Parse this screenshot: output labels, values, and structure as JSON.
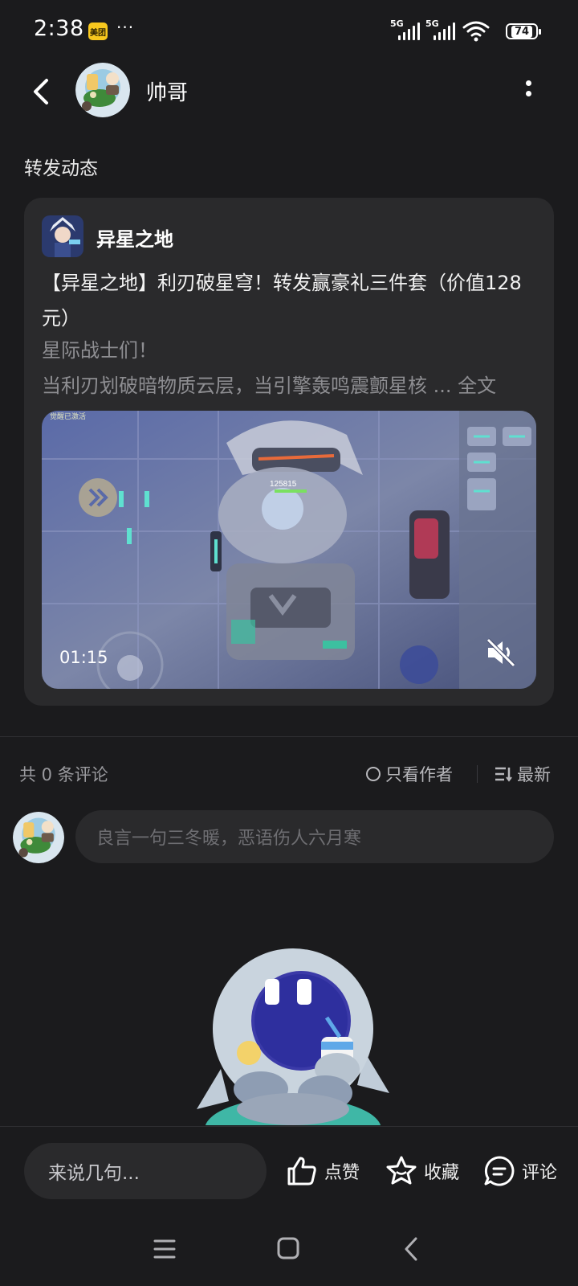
{
  "status_bar": {
    "time": "2:38",
    "app_badge": "美团",
    "more_dots": "···",
    "signal1_label": "5G",
    "signal2_label": "5G",
    "battery": "74"
  },
  "header": {
    "username": "帅哥"
  },
  "section_title": "转发动态",
  "post": {
    "game_name": "异星之地",
    "title": "【异星之地】利刃破星穹！转发赢豪礼三件套（价值128元）",
    "subtitle": "星际战士们！",
    "body": "当利刃划破暗物质云层，当引擎轰鸣震颤星核",
    "ellipsis": " ... ",
    "full_text_link": "全文",
    "video_duration": "01:15"
  },
  "comments": {
    "count_text": "共 0 条评论",
    "author_only_label": "只看作者",
    "sort_label": "最新",
    "input_placeholder": "良言一句三冬暖，恶语伤人六月寒"
  },
  "bottom_bar": {
    "say_placeholder": "来说几句...",
    "like_label": "点赞",
    "favorite_label": "收藏",
    "comment_label": "评论"
  },
  "colors": {
    "background": "#1b1b1d",
    "card": "#2a2a2c",
    "muted_text": "#8e8e92"
  }
}
